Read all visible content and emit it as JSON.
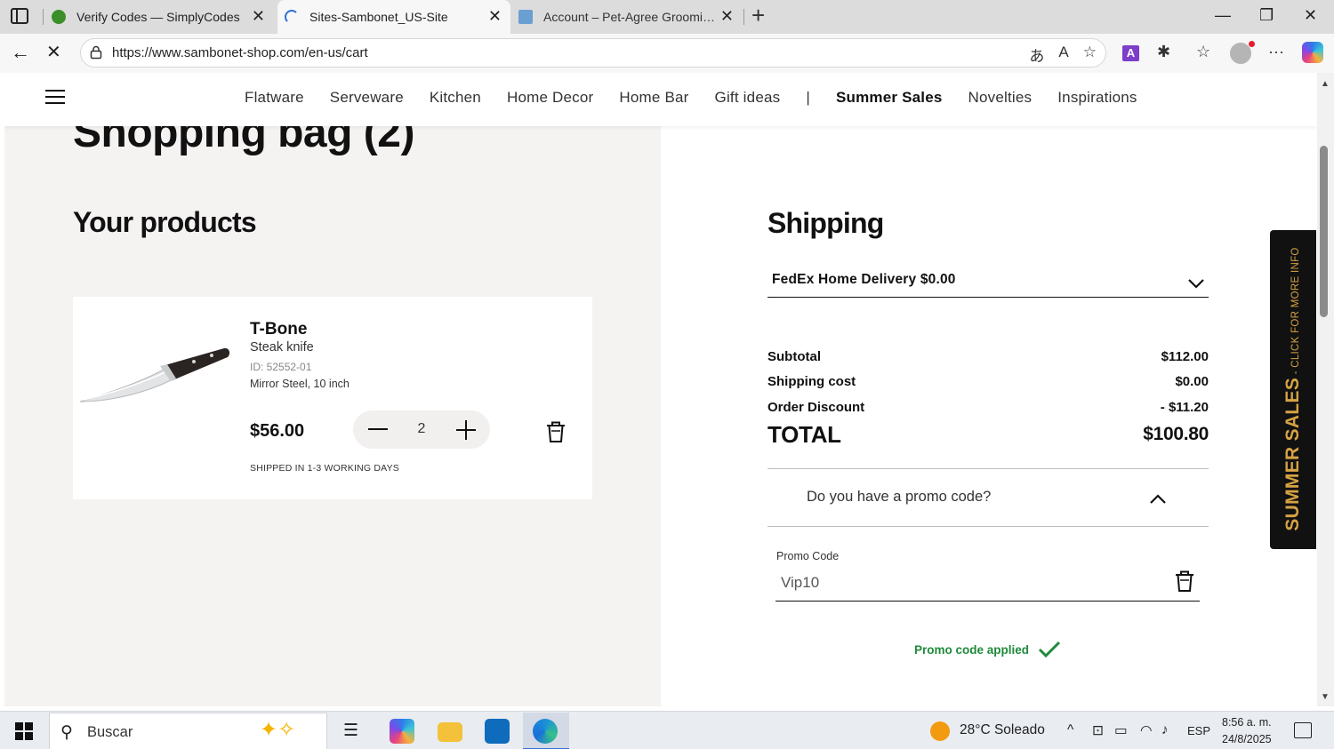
{
  "browser": {
    "tabs": [
      {
        "title": "Verify Codes — SimplyCodes",
        "active": false
      },
      {
        "title": "Sites-Sambonet_US-Site",
        "active": true
      },
      {
        "title": "Account – Pet-Agree Grooming S",
        "active": false
      }
    ],
    "url": "https://www.sambonet-shop.com/en-us/cart",
    "icons": [
      "sidebar-icon",
      "back-icon",
      "stop-icon",
      "lock-icon",
      "translate-icon",
      "read-aloud-icon",
      "favorite-icon",
      "extension-icon",
      "favorites-icon",
      "more-icon",
      "copilot-icon"
    ],
    "ext_a_label": "A"
  },
  "header": {
    "nav": [
      "Flatware",
      "Serveware",
      "Kitchen",
      "Home Decor",
      "Home Bar",
      "Gift ideas",
      "|",
      "Summer Sales",
      "Novelties",
      "Inspirations"
    ]
  },
  "cart": {
    "title": "Shopping bag (2)",
    "products_heading": "Your products",
    "product": {
      "name": "T-Bone",
      "type": "Steak knife",
      "id": "ID: 52552-01",
      "variant": "Mirror Steel, 10 inch",
      "price": "$56.00",
      "quantity": "2",
      "shipping_note": "SHIPPED IN 1-3 WORKING DAYS"
    }
  },
  "shipping": {
    "heading": "Shipping",
    "selected_method": "FedEx Home Delivery $0.00"
  },
  "summary": {
    "subtotal_label": "Subtotal",
    "subtotal": "$112.00",
    "shipping_label": "Shipping cost",
    "shipping": "$0.00",
    "discount_label": "Order Discount",
    "discount": "- $11.20",
    "total_label": "TOTAL",
    "total": "$100.80"
  },
  "promo": {
    "question": "Do you have a promo code?",
    "field_label": "Promo Code",
    "value": "Vip10",
    "status": "Promo code applied"
  },
  "side_tab": {
    "big": "SUMMER SALES",
    "small": " - CLICK FOR MORE INFO"
  },
  "taskbar": {
    "search_placeholder": "Buscar",
    "weather": "28°C  Soleado",
    "language": "ESP",
    "time": "8:56 a. m.",
    "date": "24/8/2025"
  },
  "colors": {
    "accent_gold": "#d6a243",
    "success_green": "#1f8a3b",
    "left_pane_bg": "#f5f3f2"
  }
}
